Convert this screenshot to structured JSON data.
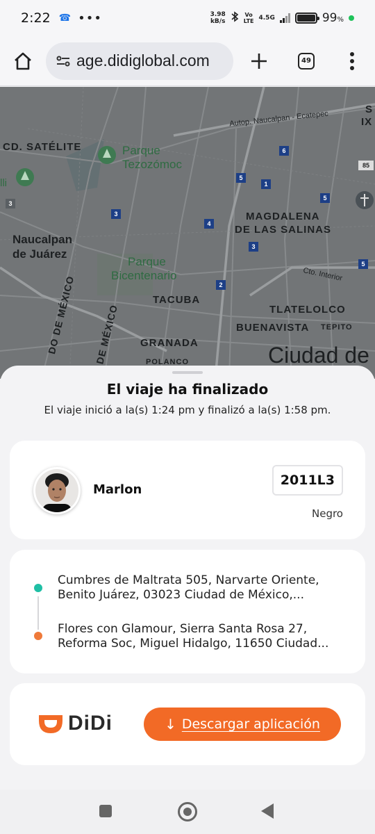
{
  "status_bar": {
    "time": "2:22",
    "speed_value": "3.98",
    "speed_unit": "kB/s",
    "volte_top": "Vo",
    "volte_bottom": "LTE",
    "network": "4.5G",
    "battery_percent": "99",
    "battery_symbol": "%",
    "battery_level": 0.99
  },
  "browser": {
    "url": "age.didiglobal.com",
    "tab_count": "49",
    "icons": [
      "home-icon",
      "site-info-icon",
      "new-tab-icon",
      "tab-switcher-icon",
      "more-options-icon"
    ]
  },
  "map": {
    "labels": {
      "satelite": "CD. SATÉLITE",
      "tezozomoc_1": "Parque",
      "tezozomoc_2": "Tezozómoc",
      "naucalpan_1": "Naucalpan",
      "naucalpan_2": "de Juárez",
      "bicentenario_1": "Parque",
      "bicentenario_2": "Bicentenario",
      "tacuba": "TACUBA",
      "granada": "GRANADA",
      "polanco": "POLANCO",
      "magdalena_1": "MAGDALENA",
      "magdalena_2": "DE LAS SALINAS",
      "tlatelolco": "TLATELOLCO",
      "buenavista": "BUENAVISTA",
      "tepito": "TEPITO",
      "ciudad": "Ciudad de",
      "autop": "Autop. Naucalpan - Ecatepec",
      "cto_interior": "Cto. Interior",
      "mexico_1": "DO DE MÉXICO",
      "mexico_2": "DE MÉXICO",
      "sierra": "S",
      "ix": "IX",
      "illi": "lli"
    },
    "shields": [
      "3",
      "3",
      "4",
      "5",
      "1",
      "6",
      "5",
      "3",
      "2",
      "85",
      "5"
    ]
  },
  "sheet": {
    "title": "El viaje ha finalizado",
    "subtitle": "El viaje inició a la(s) 1:24 pm y finalizó a la(s) 1:58 pm."
  },
  "driver": {
    "name": "Marlon",
    "plate": "2011L3",
    "car_color": "Negro"
  },
  "route": {
    "origin": [
      "Cumbres de Maltrata 505, Narvarte Oriente,",
      "Benito Juárez, 03023 Ciudad de México,..."
    ],
    "destination": [
      "Flores con Glamour, Sierra Santa Rosa 27,",
      "Reforma Soc, Miguel Hidalgo, 11650 Ciudad..."
    ],
    "origin_color": "#1fbfa5",
    "destination_color": "#ef7a3a"
  },
  "download": {
    "brand": "DiDi",
    "button_label": "Descargar aplicación",
    "brand_color": "#f26a26"
  }
}
